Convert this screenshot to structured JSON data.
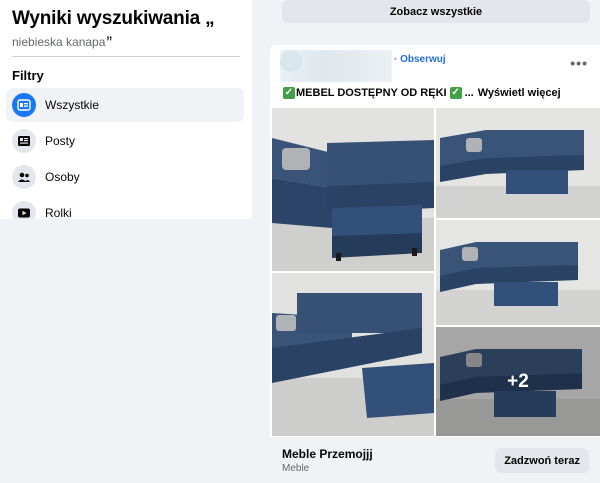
{
  "sidebar": {
    "title": "Wyniki wyszukiwania „",
    "query": "niebieska kanapa",
    "query_close": "”",
    "filters_heading": "Filtry",
    "items": [
      {
        "label": "Wszystkie",
        "icon": "feed-icon",
        "active": true
      },
      {
        "label": "Posty",
        "icon": "posts-icon",
        "active": false
      },
      {
        "label": "Osoby",
        "icon": "people-icon",
        "active": false
      },
      {
        "label": "Rolki",
        "icon": "reels-icon",
        "active": false
      }
    ]
  },
  "see_all_label": "Zobacz wszystkie",
  "post": {
    "follow_label": "· Obserwuj",
    "more_options_icon": "more-horizontal-icon",
    "text_a": "MEBEL DOSTĘPNY OD RĘKI",
    "text_b": "...",
    "see_more_label": "Wyświetl więcej",
    "check_emoji": "✓",
    "extra_photos_label": "+2",
    "footer_title": "Meble Przemojjj",
    "footer_subtitle": "Meble",
    "call_label": "Zadzwoń teraz"
  },
  "colors": {
    "accent": "#1877f2",
    "link": "#216fdb",
    "sofa": "#2f4a6e",
    "check": "#43a047"
  }
}
